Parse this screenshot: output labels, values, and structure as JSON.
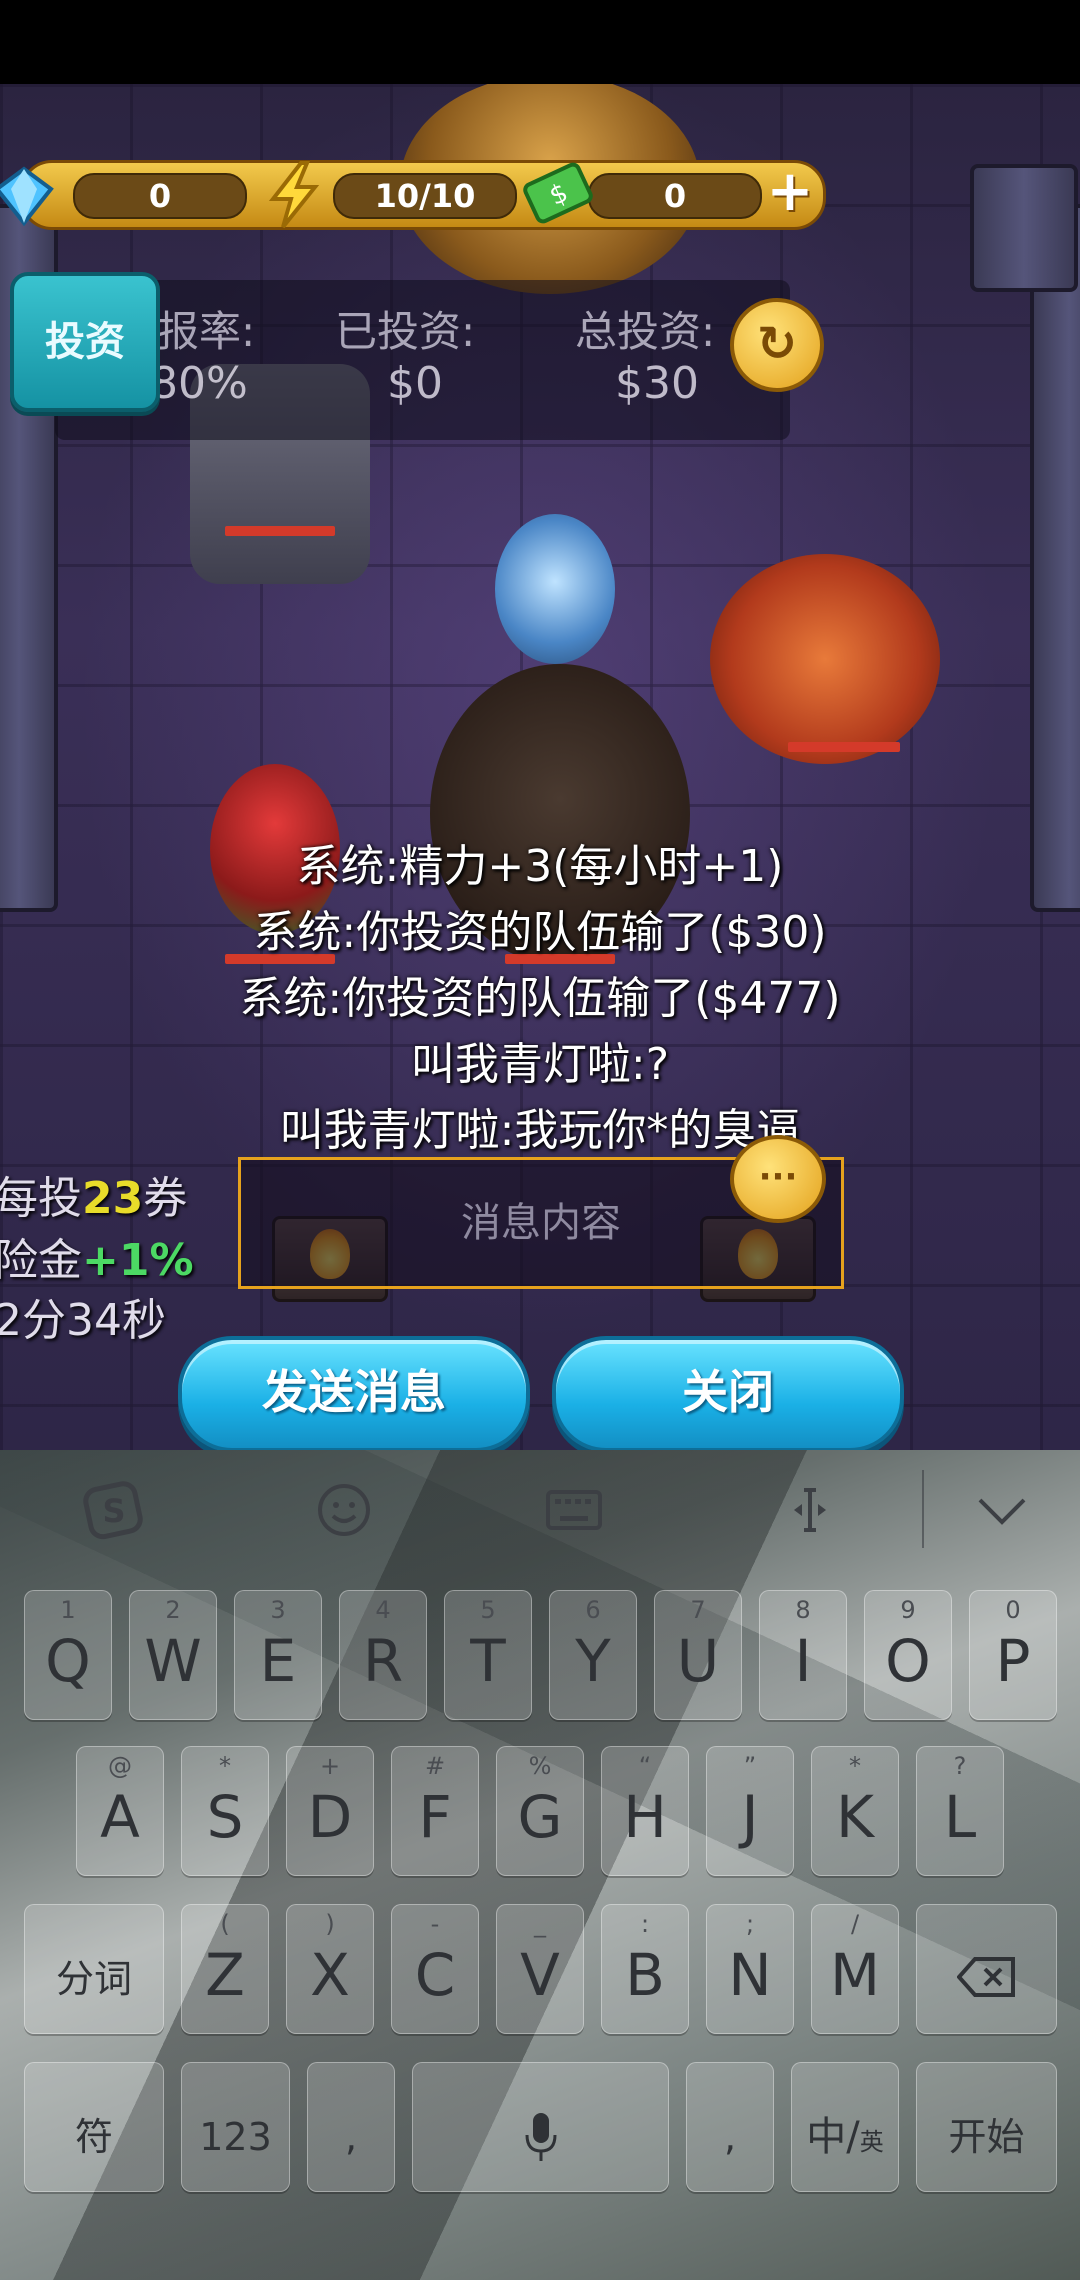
{
  "game": {
    "resources": {
      "gems": "0",
      "energy": "10/10",
      "cash": "0",
      "add_symbol": "+"
    },
    "invest_button_label": "投资",
    "info": {
      "rate_label": "报率:",
      "rate_value": "80%",
      "invested_label": "已投资:",
      "invested_value": "$0",
      "total_label": "总投资:",
      "total_value": "$30"
    },
    "chat_lines": [
      "系统:精力+3(每小时+1)",
      "系统:你投资的队伍输了($30)",
      "系统:你投资的队伍输了($477)",
      "叫我青灯啦:?",
      "叫我青灯啦:我玩你*的臭逼"
    ],
    "message_placeholder": "消息内容",
    "side": {
      "line1_prefix": "每投",
      "line1_value": "23",
      "line1_suffix": "券",
      "line2_prefix": "险金",
      "line2_value": "+1%",
      "line3": "2分34秒"
    },
    "send_button_label": "发送消息",
    "close_button_label": "关闭",
    "colors": {
      "accent_blue": "#1ab0e6",
      "gold": "#e6a21d",
      "hp_red": "#d43a2a",
      "highlight_yellow": "#e8dc2a",
      "highlight_green": "#4cd964"
    }
  },
  "keyboard": {
    "toolbar_icons": [
      "sogou-logo-icon",
      "emoji-icon",
      "keyboard-icon",
      "cursor-icon",
      "collapse-icon"
    ],
    "row1": [
      {
        "main": "Q",
        "sub": "1"
      },
      {
        "main": "W",
        "sub": "2"
      },
      {
        "main": "E",
        "sub": "3"
      },
      {
        "main": "R",
        "sub": "4"
      },
      {
        "main": "T",
        "sub": "5"
      },
      {
        "main": "Y",
        "sub": "6"
      },
      {
        "main": "U",
        "sub": "7"
      },
      {
        "main": "I",
        "sub": "8"
      },
      {
        "main": "O",
        "sub": "9"
      },
      {
        "main": "P",
        "sub": "0"
      }
    ],
    "row2": [
      {
        "main": "A",
        "sub": "@"
      },
      {
        "main": "S",
        "sub": "*"
      },
      {
        "main": "D",
        "sub": "+"
      },
      {
        "main": "F",
        "sub": "#"
      },
      {
        "main": "G",
        "sub": "%"
      },
      {
        "main": "H",
        "sub": "“"
      },
      {
        "main": "J",
        "sub": "”"
      },
      {
        "main": "K",
        "sub": "*"
      },
      {
        "main": "L",
        "sub": "?"
      }
    ],
    "row3": [
      {
        "main": "Z",
        "sub": "("
      },
      {
        "main": "X",
        "sub": ")"
      },
      {
        "main": "C",
        "sub": "-"
      },
      {
        "main": "V",
        "sub": "_"
      },
      {
        "main": "B",
        "sub": ":"
      },
      {
        "main": "N",
        "sub": ";"
      },
      {
        "main": "M",
        "sub": "/"
      }
    ],
    "fn": {
      "segment": "分词",
      "symbol": "符",
      "numbers": "123",
      "comma": ",",
      "space_icon": "microphone-icon",
      "chinese": "中",
      "english": "英",
      "go": "开始",
      "delete_icon": "backspace-icon"
    }
  }
}
